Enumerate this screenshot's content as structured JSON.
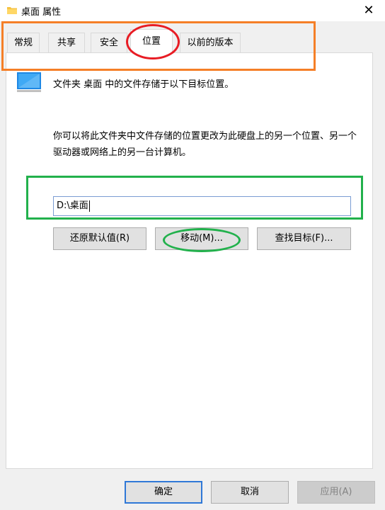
{
  "window": {
    "title": "桌面 属性",
    "close_glyph": "✕"
  },
  "tabs": [
    {
      "label": "常规",
      "active": false
    },
    {
      "label": "共享",
      "active": false
    },
    {
      "label": "安全",
      "active": false
    },
    {
      "label": "位置",
      "active": true
    },
    {
      "label": "以前的版本",
      "active": false
    }
  ],
  "location": {
    "description": "文件夹 桌面 中的文件存储于以下目标位置。",
    "explanation": "你可以将此文件夹中文件存储的位置更改为此硬盘上的另一个位置、另一个驱动器或网络上的另一台计算机。",
    "path_value": "D:\\桌面",
    "restore_default_label": "还原默认值(R)",
    "move_label": "移动(M)...",
    "find_target_label": "查找目标(F)..."
  },
  "footer": {
    "ok_label": "确定",
    "cancel_label": "取消",
    "apply_label": "应用(A)"
  },
  "icons": {
    "title": "folder-icon",
    "folder": "desktop-folder-icon",
    "close": "close-icon"
  },
  "colors": {
    "window_bg": "#f0f0f0",
    "panel_bg": "#ffffff",
    "accent_blue": "#2f78d7",
    "annotation_orange": "#f57f27",
    "annotation_red": "#e81c24",
    "annotation_green": "#22b14c"
  }
}
